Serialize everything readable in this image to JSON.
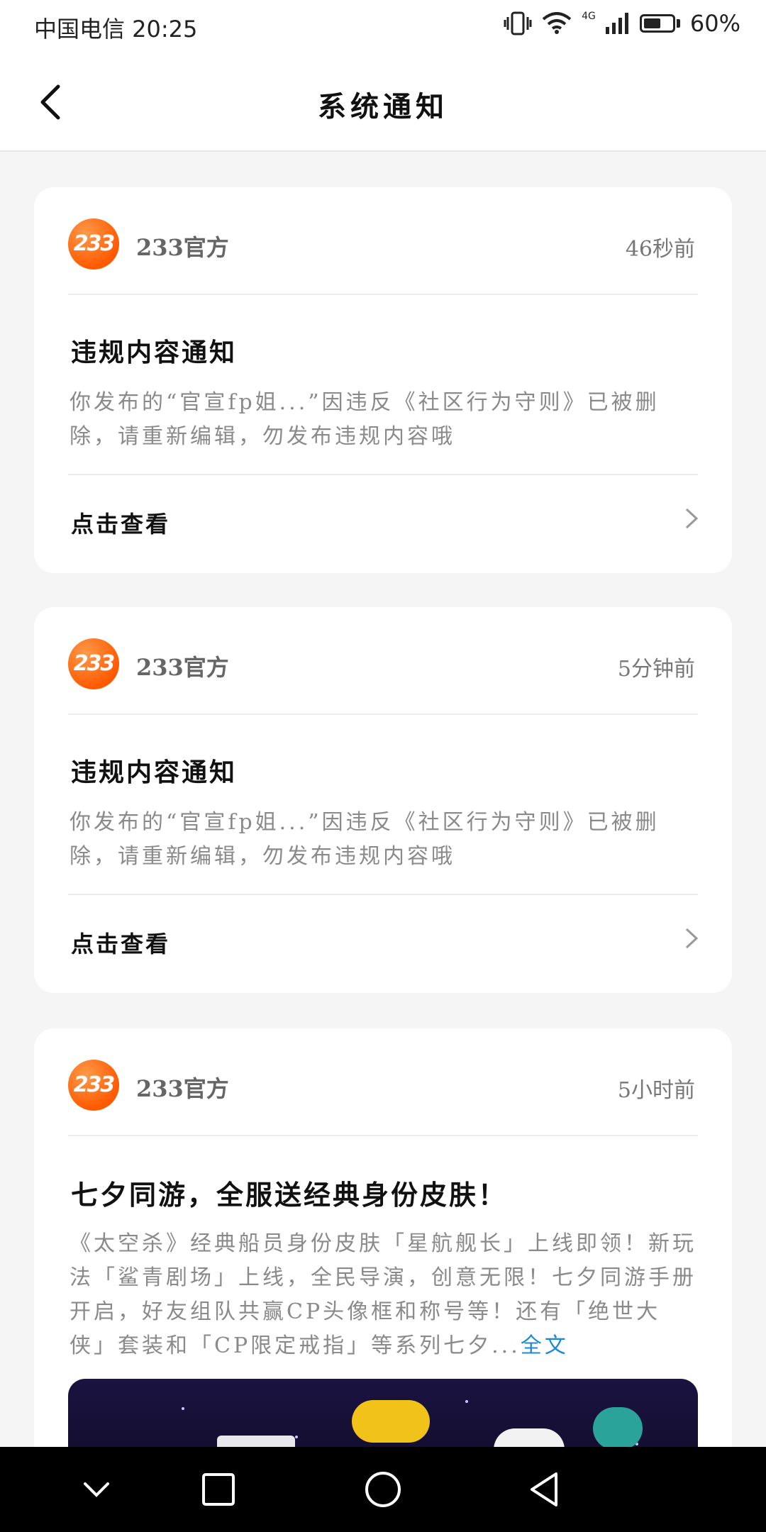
{
  "status": {
    "carrier_time": "中国电信 20:25",
    "network": "4G",
    "battery_pct": "60%",
    "battery_level": 0.6
  },
  "header": {
    "title": "系统通知"
  },
  "notifications": [
    {
      "logo": "233",
      "sender": "233官方",
      "time": "46秒前",
      "title": "违规内容通知",
      "body": "你发布的“官宣fp姐...”因违反《社区行为守则》已被删除，请重新编辑，勿发布违规内容哦",
      "action": "点击查看"
    },
    {
      "logo": "233",
      "sender": "233官方",
      "time": "5分钟前",
      "title": "违规内容通知",
      "body": "你发布的“官宣fp姐...”因违反《社区行为守则》已被删除，请重新编辑，勿发布违规内容哦",
      "action": "点击查看"
    },
    {
      "logo": "233",
      "sender": "233官方",
      "time": "5小时前",
      "title": "七夕同游，全服送经典身份皮肤！",
      "body": "《太空杀》经典船员身份皮肤「星航舰长」上线即领！新玩法「鲨青剧场」上线，全民导演，创意无限！七夕同游手册开启，好友组队共赢CP头像框和称号等！还有「绝世大侠」套装和「CP限定戒指」等系列七夕...",
      "more": "全文"
    }
  ],
  "colors": {
    "accent": "#ff5a00",
    "link": "#1a8ad8"
  },
  "icons": {
    "back": "chevron-left-icon",
    "chevron": "chevron-right-icon",
    "nav": [
      "chevron-down-icon",
      "square-icon",
      "circle-icon",
      "triangle-back-icon"
    ]
  }
}
